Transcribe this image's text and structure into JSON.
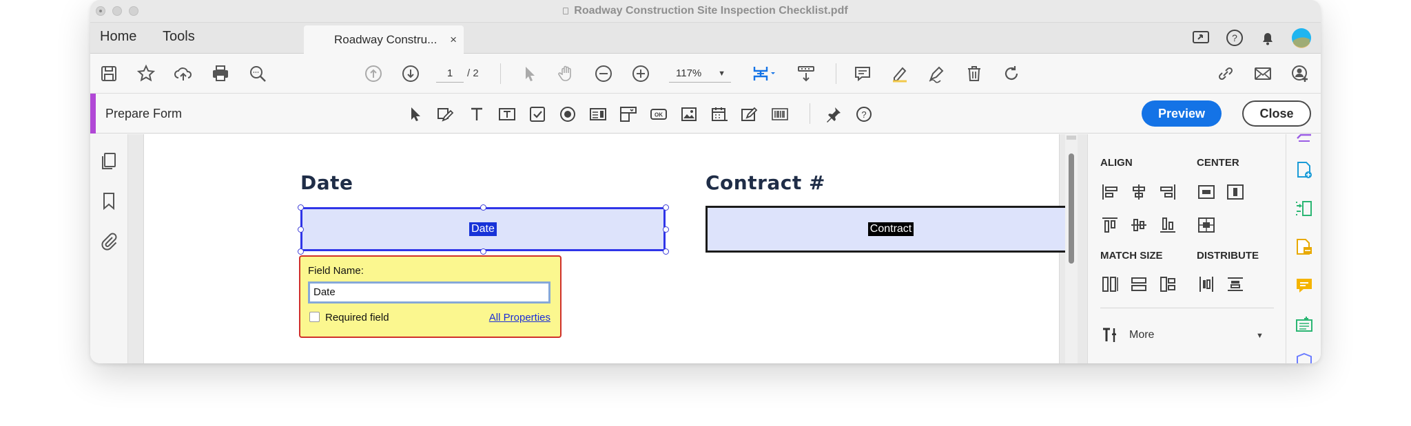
{
  "window": {
    "title": "Roadway Construction Site Inspection Checklist.pdf"
  },
  "tabbar": {
    "home": "Home",
    "tools": "Tools",
    "doc_tab": "Roadway Constru...",
    "close_glyph": "×"
  },
  "toolbar": {
    "page_current": "1",
    "page_total": "/ 2",
    "zoom": "117%"
  },
  "formbar": {
    "title": "Prepare Form",
    "preview_label": "Preview",
    "close_label": "Close"
  },
  "document": {
    "date_heading": "Date",
    "contract_heading": "Contract #",
    "date_field_text": "Date",
    "contract_field_text": "Contract"
  },
  "popup": {
    "field_name_label": "Field Name:",
    "field_name_value": "Date",
    "required_label": "Required field",
    "all_properties": "All Properties"
  },
  "right_panel": {
    "align": "ALIGN",
    "center": "CENTER",
    "match_size": "MATCH SIZE",
    "distribute": "DISTRIBUTE",
    "more": "More"
  },
  "colors": {
    "accent_purple": "#b148d6",
    "primary_blue": "#1473e6",
    "field_fill": "#dde3fb",
    "popup_yellow": "#fbf78f",
    "popup_border": "#d0302a"
  }
}
